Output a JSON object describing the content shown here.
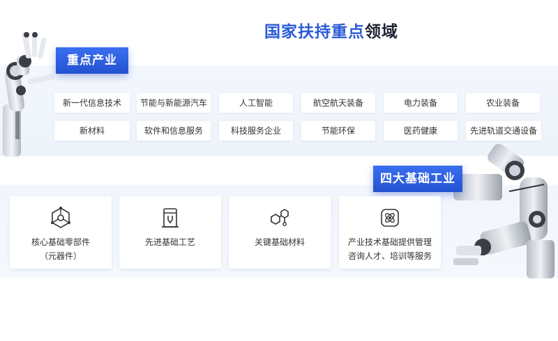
{
  "title": {
    "part_blue": "国家扶持重点",
    "part_dark": "领域"
  },
  "section1": {
    "badge": "重点产业",
    "tags": [
      "新一代信息技术",
      "节能与新能源汽车",
      "人工智能",
      "航空航天装备",
      "电力装备",
      "农业装备",
      "新材料",
      "软件和信息服务",
      "科技服务企业",
      "节能环保",
      "医药健康",
      "先进轨道交通设备"
    ]
  },
  "section2": {
    "badge": "四大基础工业",
    "cards": [
      {
        "line1": "核心基础零部件",
        "line2": "（元器件）",
        "icon": "network-hub-icon"
      },
      {
        "line1": "先进基础工艺",
        "line2": "",
        "icon": "machine-tool-icon"
      },
      {
        "line1": "关键基础材料",
        "line2": "",
        "icon": "molecule-icon"
      },
      {
        "line1": "产业技术基础提供管理",
        "line2": "咨询人才、培训等服务",
        "icon": "atom-gear-icon"
      }
    ]
  },
  "colors": {
    "accent": "#2a5bd7",
    "panel": "#f2f6fc",
    "text": "#333333"
  }
}
